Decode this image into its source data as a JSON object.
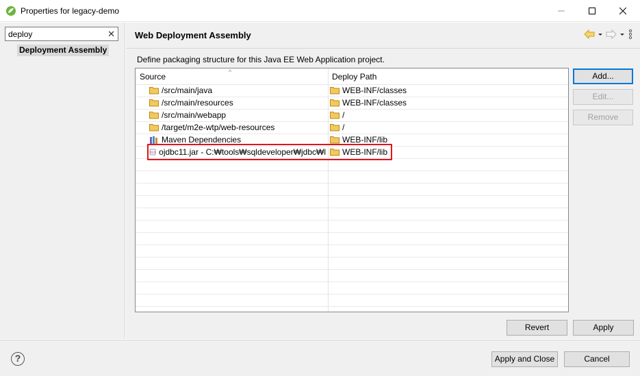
{
  "window": {
    "title": "Properties for legacy-demo",
    "controls": {
      "minimize": "–",
      "maximize": "☐",
      "close": "✕"
    }
  },
  "sidebar": {
    "filter": {
      "value": "deploy",
      "clear_icon": "✕"
    },
    "items": [
      {
        "label": "Deployment Assembly",
        "selected": true
      }
    ]
  },
  "page": {
    "title": "Web Deployment Assembly",
    "description": "Define packaging structure for this Java EE Web Application project."
  },
  "table": {
    "columns": [
      "Source",
      "Deploy Path"
    ],
    "rows": [
      {
        "source": "/src/main/java",
        "deploy": "WEB-INF/classes",
        "icon": "folder-icon"
      },
      {
        "source": "/src/main/resources",
        "deploy": "WEB-INF/classes",
        "icon": "folder-icon"
      },
      {
        "source": "/src/main/webapp",
        "deploy": "/",
        "icon": "folder-icon"
      },
      {
        "source": "/target/m2e-wtp/web-resources",
        "deploy": "/",
        "icon": "folder-icon"
      },
      {
        "source": "Maven Dependencies",
        "deploy": "WEB-INF/lib",
        "icon": "library-icon"
      },
      {
        "source": "ojdbc11.jar - C:₩tools₩sqldeveloper₩jdbc₩l",
        "deploy": "WEB-INF/lib",
        "icon": "jar-icon"
      }
    ]
  },
  "buttons": {
    "add": "Add...",
    "edit": "Edit...",
    "remove": "Remove",
    "revert": "Revert",
    "apply": "Apply",
    "apply_close": "Apply and Close",
    "cancel": "Cancel"
  },
  "colors": {
    "highlight": "#e0141a",
    "accent": "#0078d7",
    "folder": "#e8b84a"
  }
}
